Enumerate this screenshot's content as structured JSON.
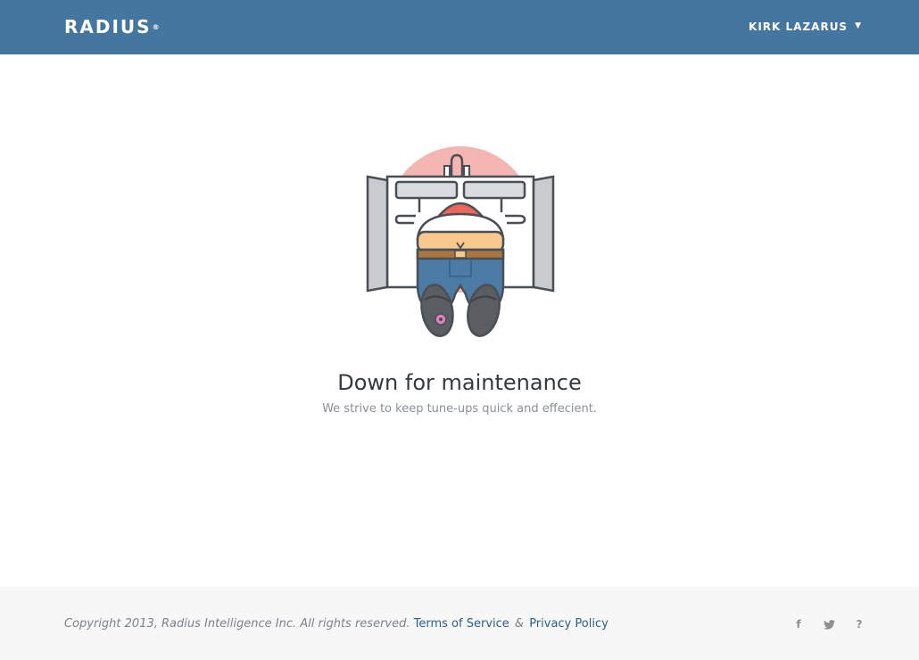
{
  "header": {
    "logo_text": "RADIUS",
    "logo_mark": "®",
    "user_name": "KIRK LAZARUS",
    "caret": "▼"
  },
  "main": {
    "headline": "Down for maintenance",
    "subline": "We strive to keep tune-ups quick and effecient."
  },
  "footer": {
    "copyright": "Copyright 2013, Radius Intelligence Inc. All rights reserved.",
    "terms_label": "Terms of Service",
    "ampersand": "&",
    "privacy_label": "Privacy Policy",
    "social": {
      "facebook_glyph": "f",
      "twitter_glyph": "🐦",
      "help_glyph": "?"
    }
  },
  "colors": {
    "header_bg": "#45769f",
    "footer_bg": "#f7f7f7",
    "link": "#2f5d84",
    "circle": "#f4b6b3"
  }
}
